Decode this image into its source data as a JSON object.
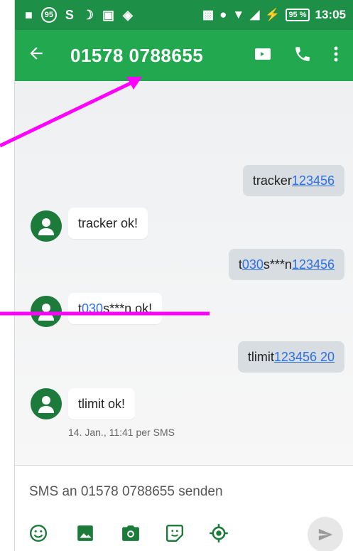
{
  "status": {
    "badge": "95",
    "battery": "95 %",
    "time": "13:05"
  },
  "header": {
    "title": "01578 0788655",
    "icons": [
      "back-arrow-icon",
      "video-call-icon",
      "phone-icon",
      "more-vert-icon"
    ]
  },
  "messages": [
    {
      "dir": "out",
      "pre": "tracker",
      "link": "123456",
      "post": ""
    },
    {
      "dir": "in",
      "pre": "tracker ok!",
      "link": "",
      "post": ""
    },
    {
      "dir": "out",
      "pre": "t",
      "link": "030",
      "mid": "s***n",
      "link2": "123456"
    },
    {
      "dir": "in",
      "pre": "t",
      "link": "030",
      "post": "s***n ok!"
    },
    {
      "dir": "out",
      "pre": "tlimit",
      "link": "123456 20",
      "post": ""
    },
    {
      "dir": "in",
      "pre": "tlimit ok!",
      "link": "",
      "post": ""
    }
  ],
  "timestamp": "14. Jan., 11:41 per SMS",
  "compose": {
    "placeholder": "SMS an 01578 0788655 senden",
    "tools": [
      "emoji-icon",
      "image-icon",
      "camera-icon",
      "sticker-icon",
      "location-icon"
    ]
  },
  "colors": {
    "statusbar": "#1e8f46",
    "appbar": "#22a84f",
    "avatar": "#1c7a3b",
    "annotation": "#ff00ff",
    "link": "#2d6fe6"
  }
}
